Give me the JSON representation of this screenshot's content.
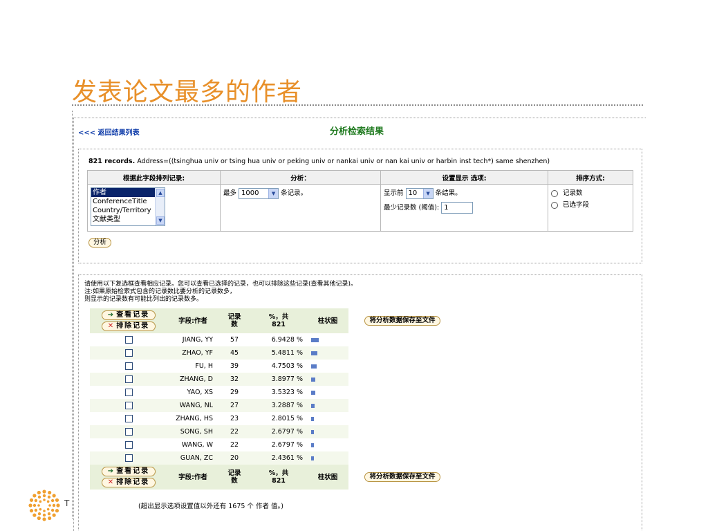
{
  "slide": {
    "title": "发表论文最多的作者",
    "logo_letter": "T"
  },
  "page": {
    "back_link": "<<< 返回结果列表",
    "heading": "分析检索结果",
    "records_bold": "821 records.",
    "records_query": "Address=((tsinghua univ or tsing hua univ or peking univ or nankai univ or nan kai univ or harbin inst tech*) same shenzhen)"
  },
  "setup": {
    "col_rank": "根据此字段排列记录:",
    "col_analysis": "分析：",
    "col_display": "设置显示 选项:",
    "col_sort": "排序方式:",
    "field_options": [
      "作者",
      "ConferenceTitle",
      "Country/Territory",
      "文献类型"
    ],
    "analysis_prefix": "最多",
    "analysis_value": "1000",
    "analysis_suffix": "条记录。",
    "display_prefix": "显示前",
    "display_value": "10",
    "display_suffix": "条结果。",
    "min_label": "最少记录数 (阈值):",
    "min_value": "1",
    "sort_options": [
      "记录数",
      "已选字段"
    ],
    "analyze_button": "分析"
  },
  "results": {
    "note_lines": [
      "请使用以下复选框查看相应记录。您可以查看已选择的记录，也可以排除这些记录(查看其他记录)。",
      "注:如果原始检索式包含的记录数比要分析的记录数多，",
      "则显示的记录数有可能比列出的记录数多。"
    ],
    "view_button": "查看记录",
    "exclude_button": "排除记录",
    "header_field": "字段:作者",
    "header_count_line1": "记录",
    "header_count_line2": "数",
    "header_pct_line1": "%，共",
    "header_pct_line2": "821",
    "header_chart": "柱状图",
    "save_button": "将分析数据保存至文件",
    "rows": [
      {
        "name": "JIANG, YY",
        "count": "57",
        "pct": "6.9428 %",
        "value": 6.9428
      },
      {
        "name": "ZHAO, YF",
        "count": "45",
        "pct": "5.4811 %",
        "value": 5.4811
      },
      {
        "name": "FU, H",
        "count": "39",
        "pct": "4.7503 %",
        "value": 4.7503
      },
      {
        "name": "ZHANG, D",
        "count": "32",
        "pct": "3.8977 %",
        "value": 3.8977
      },
      {
        "name": "YAO, XS",
        "count": "29",
        "pct": "3.5323 %",
        "value": 3.5323
      },
      {
        "name": "WANG, NL",
        "count": "27",
        "pct": "3.2887 %",
        "value": 3.2887
      },
      {
        "name": "ZHANG, HS",
        "count": "23",
        "pct": "2.8015 %",
        "value": 2.8015
      },
      {
        "name": "SONG, SH",
        "count": "22",
        "pct": "2.6797 %",
        "value": 2.6797
      },
      {
        "name": "WANG, W",
        "count": "22",
        "pct": "2.6797 %",
        "value": 2.6797
      },
      {
        "name": "GUAN, ZC",
        "count": "20",
        "pct": "2.4361 %",
        "value": 2.4361
      }
    ],
    "footer_note": "(超出显示选项设置值以外还有 1675 个 作者 值。)"
  },
  "colors": {
    "title": "#e8902a",
    "heading": "#1f7a1f",
    "link": "#0b39a8",
    "bar": "#5a7cc7"
  }
}
